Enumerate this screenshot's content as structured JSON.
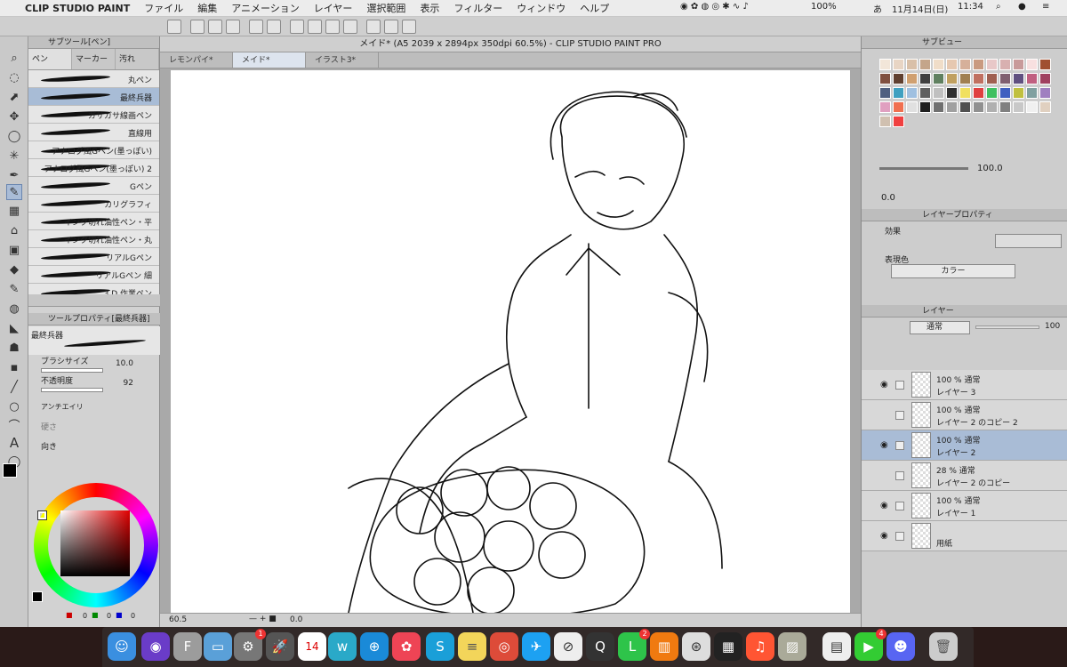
{
  "menubar": {
    "app": "CLIP STUDIO PAINT",
    "items": [
      "ファイル",
      "編集",
      "アニメーション",
      "レイヤー",
      "選択範囲",
      "表示",
      "フィルター",
      "ウィンドウ",
      "ヘルプ"
    ],
    "battery": "100%",
    "ime": "あ",
    "date": "11月14日(日)",
    "time": "11:34"
  },
  "subtool": {
    "title": "サブツール[ペン]",
    "tabs": [
      "ペン",
      "マーカー",
      "汚れ"
    ],
    "brushes": [
      "丸ペン",
      "最終兵器",
      "ガサガサ線画ペン",
      "直線用",
      "アナログ風Gペン(墨っぽい)",
      "アナログ風Gペン(墨っぽい) 2",
      "Gペン",
      "カリグラフィ",
      "インク切れ油性ペン・平",
      "インク切れ油性ペン・丸",
      "リアルGペン",
      "リアルGペン 細",
      "3 D 作業ペン"
    ],
    "selected_index": 1
  },
  "toolprop": {
    "title": "ツールプロパティ[最終兵器]",
    "brush_name": "最終兵器",
    "size_label": "ブラシサイズ",
    "size_value": "10.0",
    "opacity_label": "不透明度",
    "opacity_value": "92",
    "aa_label": "アンチエイリ",
    "hardness_label": "硬さ",
    "direction_label": "向き"
  },
  "color": {
    "r": "0",
    "g": "0",
    "b": "0",
    "accent": "#e00000"
  },
  "canvas": {
    "title": "メイド* (A5 2039 x 2894px 350dpi 60.5%)  - CLIP STUDIO PAINT PRO",
    "tabs": [
      "レモンパイ*",
      "メイド*",
      "イラスト3*"
    ],
    "active_tab": 1,
    "zoom": "60.5",
    "angle": "0.0"
  },
  "right": {
    "subview_title": "サブビュー",
    "zoom_value": "100.0",
    "zoom_value2": "0.0",
    "layerprop_title": "レイヤープロパティ",
    "effect_label": "効果",
    "express_label": "表現色",
    "express_value": "カラー",
    "layer_title": "レイヤー",
    "blend": "通常",
    "opacity": "100"
  },
  "layers": [
    {
      "l1": "100 % 通常",
      "l2": "レイヤー 3",
      "visible": true,
      "selected": false
    },
    {
      "l1": "100 % 通常",
      "l2": "レイヤー 2 のコピー 2",
      "visible": false,
      "selected": false
    },
    {
      "l1": "100 % 通常",
      "l2": "レイヤー 2",
      "visible": true,
      "selected": true
    },
    {
      "l1": "28 % 通常",
      "l2": "レイヤー 2 のコピー",
      "visible": false,
      "selected": false
    },
    {
      "l1": "100 % 通常",
      "l2": "レイヤー 1",
      "visible": true,
      "selected": false
    },
    {
      "l1": "",
      "l2": "用紙",
      "visible": true,
      "selected": false
    }
  ],
  "dock": {
    "calendar_day": "14",
    "badge1": "1",
    "badge2": "2",
    "badge3": "4"
  }
}
